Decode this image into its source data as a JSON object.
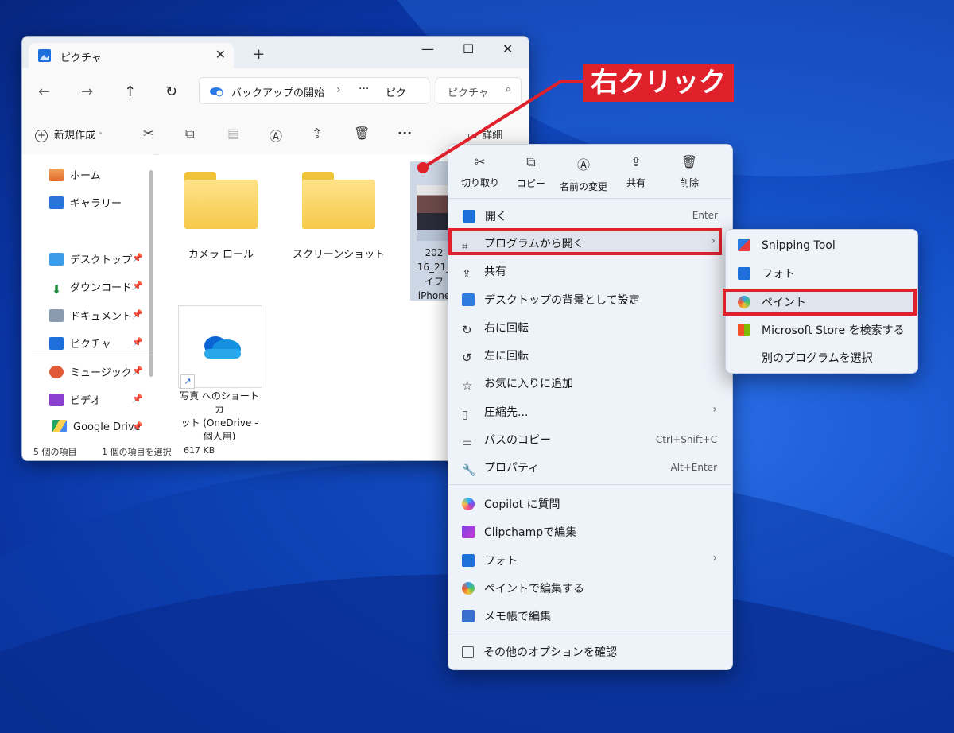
{
  "explorer": {
    "tab_title": "ピクチャ",
    "new_tab_symbol": "+",
    "address_path": "バックアップの開始",
    "address_tail": "ピク",
    "address_more": "···",
    "search_placeholder": "ピクチャ",
    "toolbar_new": "新規作成",
    "toolbar_more": "···",
    "toolbar_details": "詳細",
    "nav": [
      {
        "label": "ホーム",
        "icon": "home-icon"
      },
      {
        "label": "ギャラリー",
        "icon": "gallery-icon"
      },
      {
        "label": "デスクトップ",
        "icon": "desktop-icon"
      },
      {
        "label": "ダウンロード",
        "icon": "download-icon"
      },
      {
        "label": "ドキュメント",
        "icon": "document-icon"
      },
      {
        "label": "ピクチャ",
        "icon": "pictures-icon"
      },
      {
        "label": "ミュージック",
        "icon": "music-icon"
      },
      {
        "label": "ビデオ",
        "icon": "video-icon"
      },
      {
        "label": "Google Drive",
        "icon": "google-drive-icon"
      }
    ],
    "items": [
      {
        "label": "カメラ ロール"
      },
      {
        "label": "スクリーンショット"
      }
    ],
    "selected_file": {
      "line1": "202",
      "line2": "16_21_",
      "line3": "イフ",
      "line4": "iPhone"
    },
    "shortcut": {
      "line1": "写真 へのショートカ",
      "line2": "ット (OneDrive -",
      "line3": "個人用)"
    },
    "status": {
      "count": "5 個の項目",
      "selected": "1 個の項目を選択",
      "size": "617 KB"
    }
  },
  "context_menu": {
    "quick_actions": [
      {
        "label": "切り取り",
        "icon": "scissors-icon",
        "glyph": "✂"
      },
      {
        "label": "コピー",
        "icon": "copy-icon",
        "glyph": "⧉"
      },
      {
        "label": "名前の変更",
        "icon": "rename-icon",
        "glyph": "Ⓐ"
      },
      {
        "label": "共有",
        "icon": "share-icon",
        "glyph": "⇪"
      },
      {
        "label": "削除",
        "icon": "trash-icon",
        "glyph": "🗑"
      }
    ],
    "items": [
      {
        "label": "開く",
        "accel": "Enter"
      },
      {
        "label": "プログラムから開く",
        "submenu": "›"
      },
      {
        "label": "共有"
      },
      {
        "label": "デスクトップの背景として設定"
      },
      {
        "label": "右に回転"
      },
      {
        "label": "左に回転"
      },
      {
        "label": "お気に入りに追加"
      },
      {
        "label": "圧縮先...",
        "submenu": "›"
      },
      {
        "label": "パスのコピー",
        "accel": "Ctrl+Shift+C"
      },
      {
        "label": "プロパティ",
        "accel": "Alt+Enter"
      },
      {
        "label": "Copilot に質問"
      },
      {
        "label": "Clipchampで編集"
      },
      {
        "label": "フォト",
        "submenu": "›"
      },
      {
        "label": "ペイントで編集する"
      },
      {
        "label": "メモ帳で編集"
      },
      {
        "label": "その他のオプションを確認"
      }
    ]
  },
  "submenu": {
    "items": [
      {
        "label": "Snipping Tool"
      },
      {
        "label": "フォト"
      },
      {
        "label": "ペイント"
      },
      {
        "label": "Microsoft Store を検索する"
      },
      {
        "label": "別のプログラムを選択"
      }
    ]
  },
  "annotation": {
    "label": "右クリック"
  },
  "colors": {
    "annotation_red": "#e0202b",
    "desktop_blue": "#1450c8",
    "folder_yellow": "#f6c94a"
  }
}
